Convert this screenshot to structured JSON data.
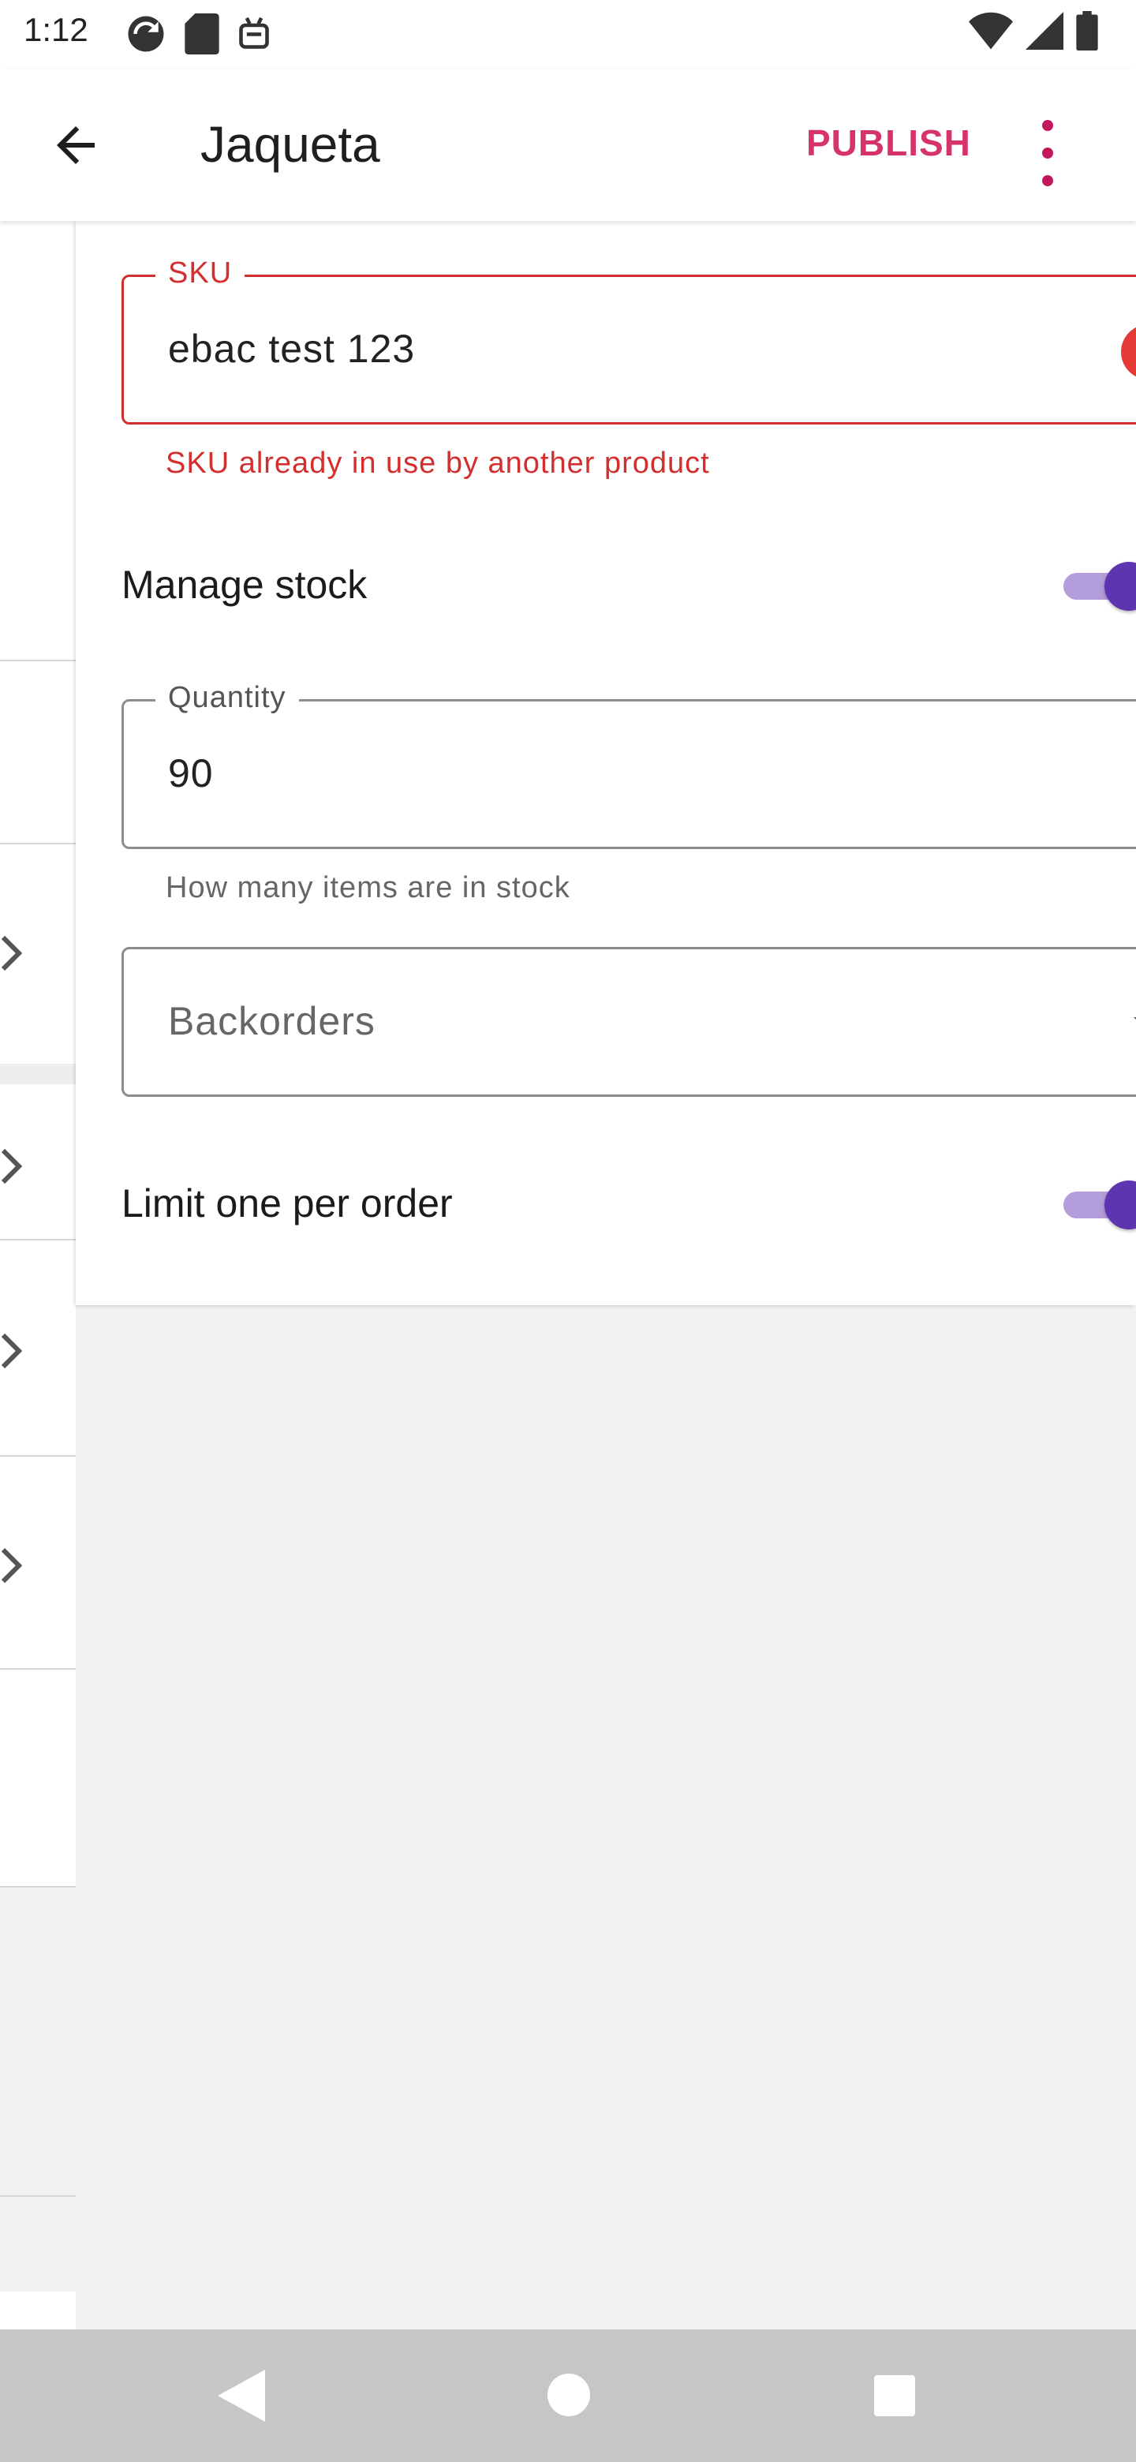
{
  "status_bar": {
    "time": "1:12",
    "left_icons": [
      "sync-icon",
      "sd-card-icon",
      "android-icon"
    ],
    "right_icons": [
      "wifi-icon",
      "cell-signal-icon",
      "battery-icon"
    ]
  },
  "app_bar": {
    "title": "Jaqueta",
    "publish_label": "PUBLISH",
    "accent_color": "#d6336c"
  },
  "form": {
    "sku": {
      "label": "SKU",
      "value": "ebac test 123",
      "error": "SKU already in use by another product"
    },
    "manage_stock": {
      "label": "Manage stock",
      "enabled": true
    },
    "quantity": {
      "label": "Quantity",
      "value": "90",
      "helper": "How many items are in stock"
    },
    "backorders": {
      "placeholder": "Backorders"
    },
    "limit_one_per_order": {
      "label": "Limit one per order",
      "enabled": true
    }
  },
  "colors": {
    "error": "#d32f2f",
    "toggle_thumb": "#5e35b1",
    "toggle_track": "#b39ddb"
  }
}
